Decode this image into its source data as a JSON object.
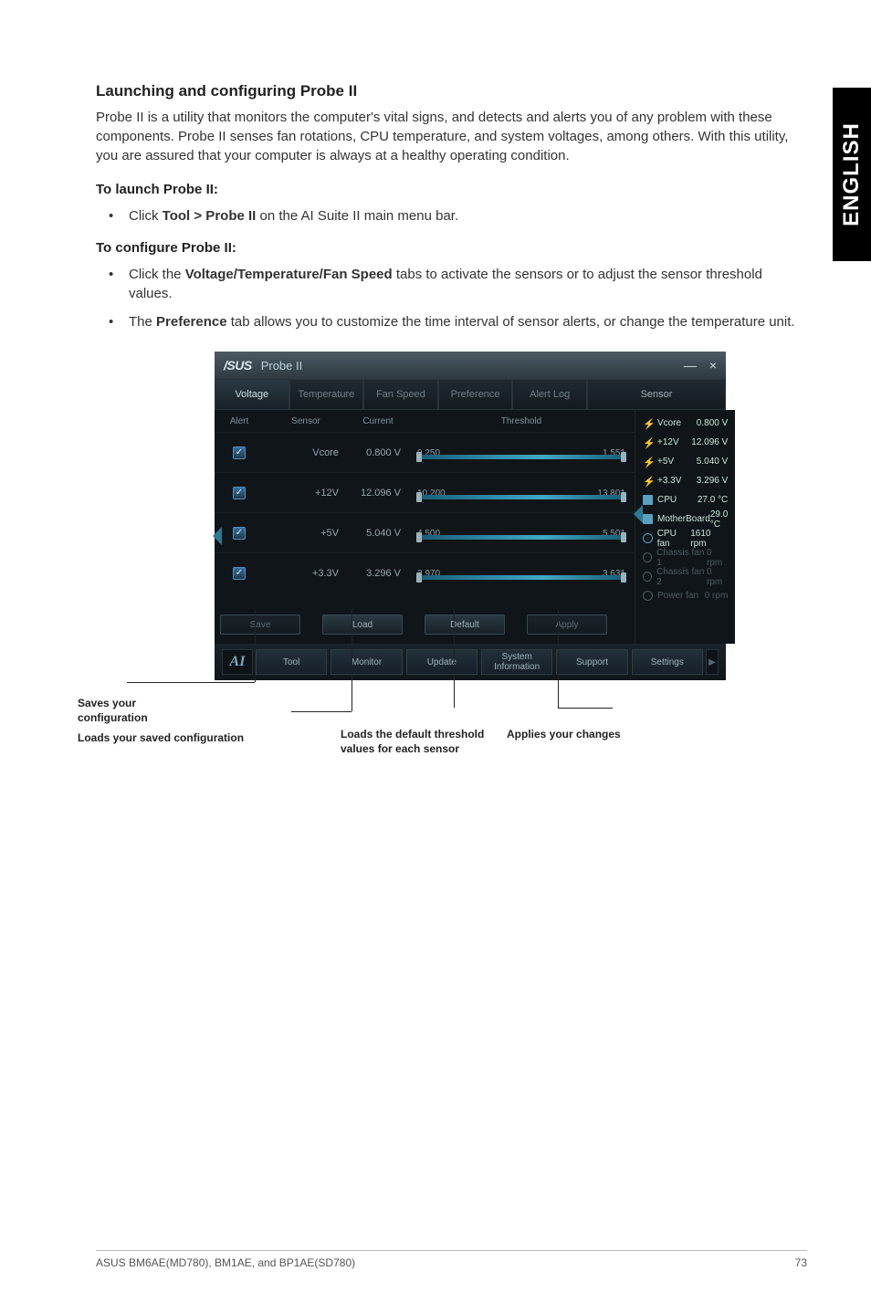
{
  "sideTab": "ENGLISH",
  "sectionTitle": "Launching and configuring Probe II",
  "intro": "Probe II is a utility that monitors the computer's vital signs, and detects and alerts you of any problem with these components. Probe II senses fan rotations, CPU temperature, and system voltages, among others. With this utility, you are assured that your computer is always at a healthy operating condition.",
  "launchHead": "To launch Probe II:",
  "launchItem_pre": "Click ",
  "launchItem_bold": "Tool > Probe II",
  "launchItem_post": " on the AI Suite II main menu bar.",
  "configHead": "To configure Probe II:",
  "config1_pre": "Click the ",
  "config1_bold": "Voltage/Temperature/Fan Speed",
  "config1_post": " tabs to activate the sensors or to adjust the sensor threshold values.",
  "config2_pre": "The ",
  "config2_bold": "Preference",
  "config2_post": " tab allows you to customize the time interval of sensor alerts, or change the temperature unit.",
  "app": {
    "brand": "/SUS",
    "name": "Probe II",
    "min": "—",
    "close": "×",
    "tabs": {
      "voltage": "Voltage",
      "temperature": "Temperature",
      "fanspeed": "Fan Speed",
      "preference": "Preference",
      "alertlog": "Alert Log"
    },
    "sensorHeader": "Sensor",
    "cols": {
      "alert": "Alert",
      "sensor": "Sensor",
      "current": "Current",
      "threshold": "Threshold"
    },
    "rows": [
      {
        "sensor": "Vcore",
        "current": "0.800 V",
        "lo": "0.250",
        "hi": "1.551"
      },
      {
        "sensor": "+12V",
        "current": "12.096 V",
        "lo": "10.200",
        "hi": "13.801"
      },
      {
        "sensor": "+5V",
        "current": "5.040 V",
        "lo": "4.500",
        "hi": "5.501"
      },
      {
        "sensor": "+3.3V",
        "current": "3.296 V",
        "lo": "2.970",
        "hi": "3.631"
      }
    ],
    "btns": {
      "save": "Save",
      "load": "Load",
      "default": "Default",
      "apply": "Apply"
    },
    "sensorList": [
      {
        "icon": "bolt",
        "name": "Vcore",
        "val": "0.800 V",
        "dim": false
      },
      {
        "icon": "bolt",
        "name": "+12V",
        "val": "12.096 V",
        "dim": false
      },
      {
        "icon": "bolt",
        "name": "+5V",
        "val": "5.040 V",
        "dim": false
      },
      {
        "icon": "bolt",
        "name": "+3.3V",
        "val": "3.296 V",
        "dim": false
      },
      {
        "icon": "chip",
        "name": "CPU",
        "val": "27.0 °C",
        "dim": false
      },
      {
        "icon": "chip",
        "name": "MotherBoard",
        "val": "29.0 °C",
        "dim": false
      },
      {
        "icon": "fan",
        "name": "CPU fan",
        "val": "1610 rpm",
        "dim": false
      },
      {
        "icon": "fan",
        "name": "Chassis fan 1",
        "val": "0 rpm",
        "dim": true
      },
      {
        "icon": "fan",
        "name": "Chassis fan 2",
        "val": "0 rpm",
        "dim": true
      },
      {
        "icon": "fan",
        "name": "Power fan",
        "val": "0 rpm",
        "dim": true
      }
    ],
    "bottombar": {
      "tool": "Tool",
      "monitor": "Monitor",
      "update": "Update",
      "sysinfo": "System\nInformation",
      "support": "Support",
      "settings": "Settings"
    }
  },
  "callouts": {
    "saves": "Saves your configuration",
    "loads": "Loads your saved configuration",
    "defaults": "Loads the default threshold values for each sensor",
    "applies": "Applies your changes"
  },
  "footer": {
    "left": "ASUS BM6AE(MD780), BM1AE, and BP1AE(SD780)",
    "right": "73"
  }
}
